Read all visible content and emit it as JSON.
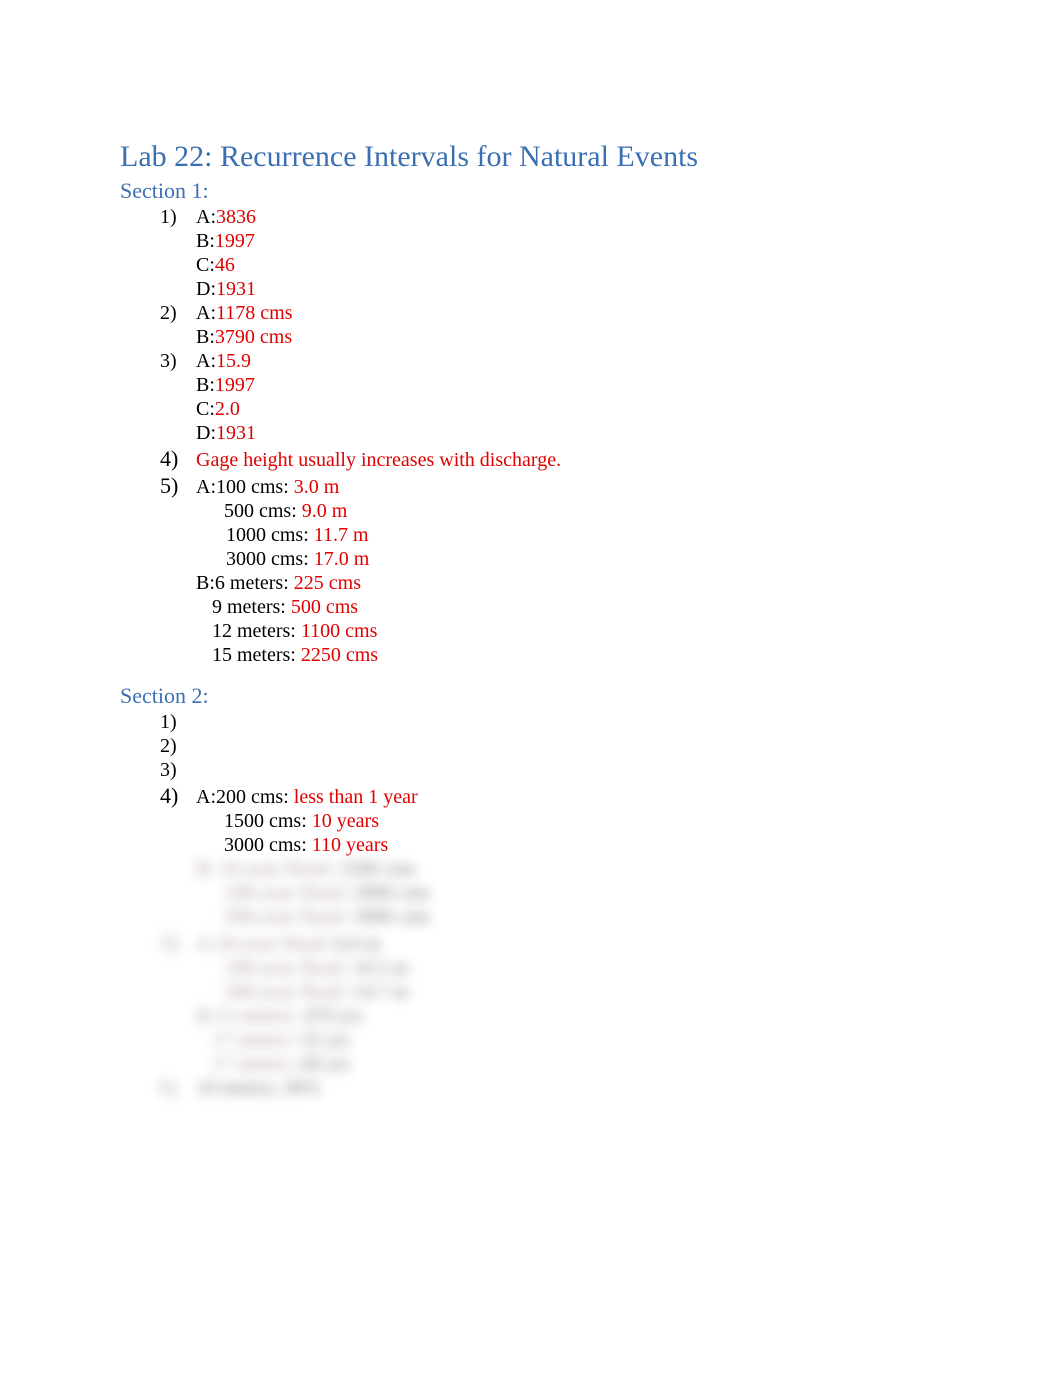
{
  "title": "Lab 22: Recurrence Intervals for Natural Events",
  "section1": {
    "header": "Section 1:",
    "q1": {
      "num": "1)",
      "A_label": "A:",
      "A": "3836",
      "B_label": "B:",
      "B": "1997",
      "C_label": "C:",
      "C": "46",
      "D_label": "D:",
      "D": "1931"
    },
    "q2": {
      "num": "2)",
      "A_label": "A:",
      "A": "1178 cms",
      "B_label": "B:",
      "B": "3790 cms"
    },
    "q3": {
      "num": "3)",
      "A_label": "A:",
      "A": "15.9",
      "B_label": "B:",
      "B": "1997",
      "C_label": "C:",
      "C": "2.0",
      "D_label": "D:",
      "D": "1931"
    },
    "q4": {
      "num": "4)",
      "text": "Gage height usually increases with discharge."
    },
    "q5": {
      "num": "5)",
      "A_label": "A:",
      "A1_k": "100 cms: ",
      "A1_v": "3.0 m",
      "A2_k": "500 cms: ",
      "A2_v": "9.0 m",
      "A3_k": "1000 cms: ",
      "A3_v": "11.7 m",
      "A4_k": "3000 cms: ",
      "A4_v": "17.0 m",
      "B_label": "B:",
      "B1_k": "6 meters:  ",
      "B1_v": "225 cms",
      "B2_k": "9 meters:  ",
      "B2_v": "500 cms",
      "B3_k": "12 meters:  ",
      "B3_v": "1100 cms",
      "B4_k": "15 meters:  ",
      "B4_v": "2250 cms"
    }
  },
  "section2": {
    "header": "Section 2:",
    "q1": {
      "num": "1)"
    },
    "q2": {
      "num": "2)"
    },
    "q3": {
      "num": "3)"
    },
    "q4": {
      "num": "4)",
      "A_label": "A:",
      "A1_k": "200 cms: ",
      "A1_v": "less than 1 year",
      "A2_k": "1500 cms: ",
      "A2_v": "10 years",
      "A3_k": "3000 cms: ",
      "A3_v": "110 years",
      "B_label": "B:",
      "B1_k": "10-year flood: ",
      "B1_v": "1500 cms",
      "B2_k": "100-year flood: ",
      "B2_v": "2900 cms",
      "B3_k": "500-year flood: ",
      "B3_v": "3900 cms"
    },
    "q5": {
      "num": "5)",
      "A_label": "A:",
      "A1_k": "10-year flood: ",
      "A1_v": "6.0 m",
      "A2_k": "100-year flood: ",
      "A2_v": "10.5 m",
      "A3_k": "500-year flood: ",
      "A3_v": "14.7 m",
      "B_label": "B:",
      "B1_k": "15 meters:  ",
      "B1_v": "470 yrs",
      "B2_k": "17 meters:  ",
      "B2_v": "55 yrs",
      "B3_k": "17 meters:  ",
      "B3_v": "60 yrs"
    },
    "q6": {
      "num": "6)",
      "text": "10 meters, 90%"
    }
  }
}
